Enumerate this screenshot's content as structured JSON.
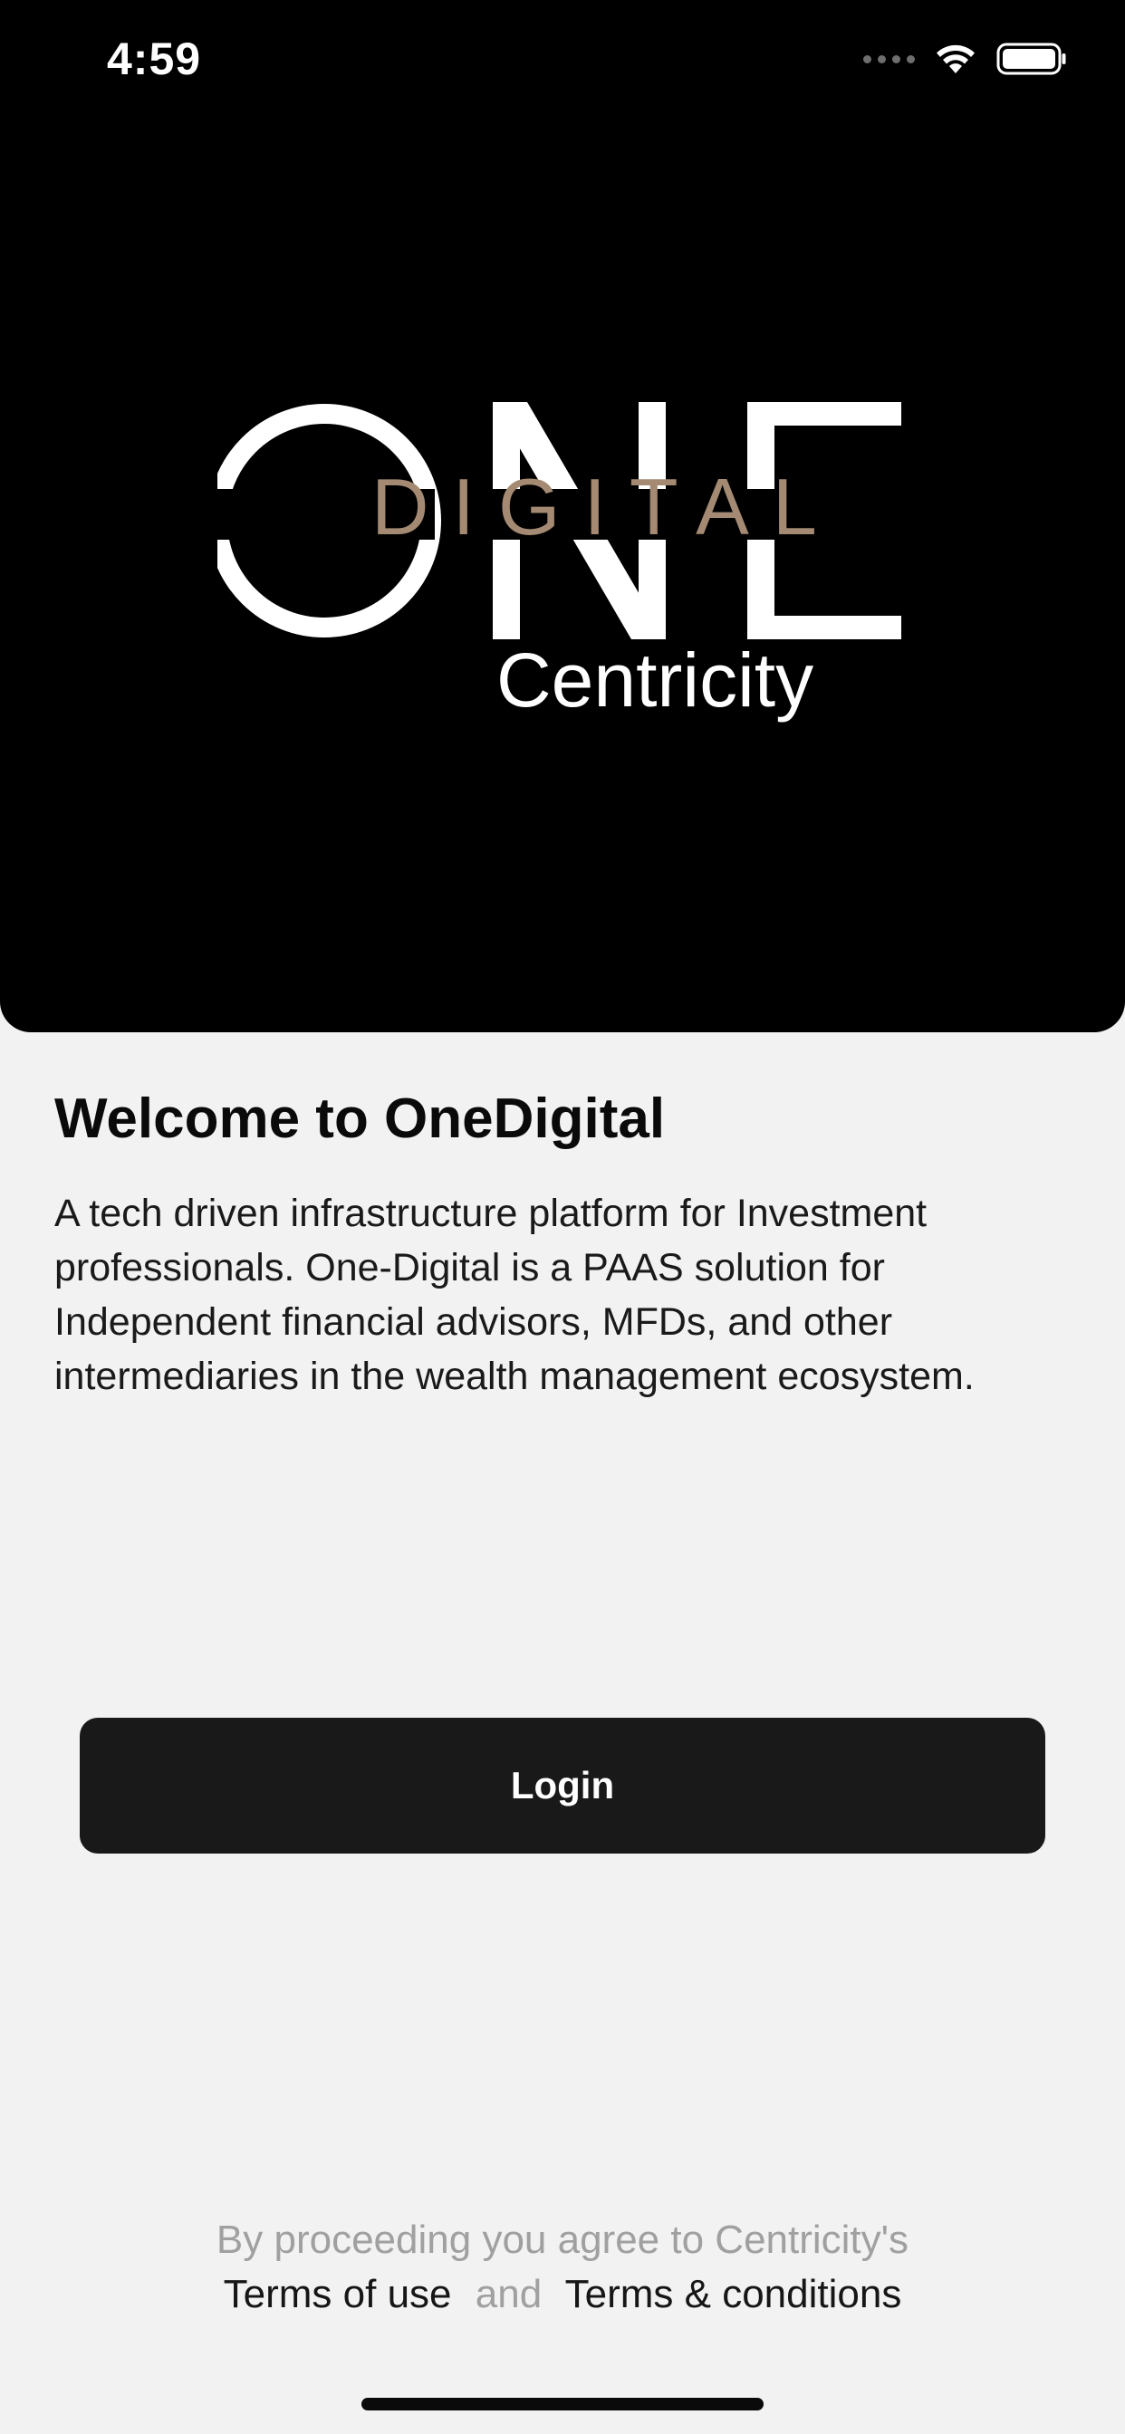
{
  "status_bar": {
    "time": "4:59",
    "wifi_icon": "wifi-icon",
    "battery_icon": "battery-icon",
    "signal_icon": "cellular-signal-icon"
  },
  "logo": {
    "word_main": "ONE",
    "word_overlay": "DIGITAL",
    "subtitle": "Centricity",
    "overlay_color": "#a48a72"
  },
  "welcome": {
    "title": "Welcome to OneDigital",
    "description": "A tech driven infrastructure platform for Investment professionals. One-Digital is a PAAS solution for Independent financial advisors, MFDs, and other intermediaries in the wealth management ecosystem."
  },
  "login_button": {
    "label": "Login"
  },
  "legal": {
    "line1": "By proceeding you agree to Centricity's",
    "terms_of_use": "Terms of use",
    "and": "and",
    "terms_conditions": "Terms & conditions"
  },
  "colors": {
    "hero_bg": "#000000",
    "page_bg": "#f2f2f2",
    "button_bg": "#191919",
    "muted_text": "#a0a0a0"
  }
}
